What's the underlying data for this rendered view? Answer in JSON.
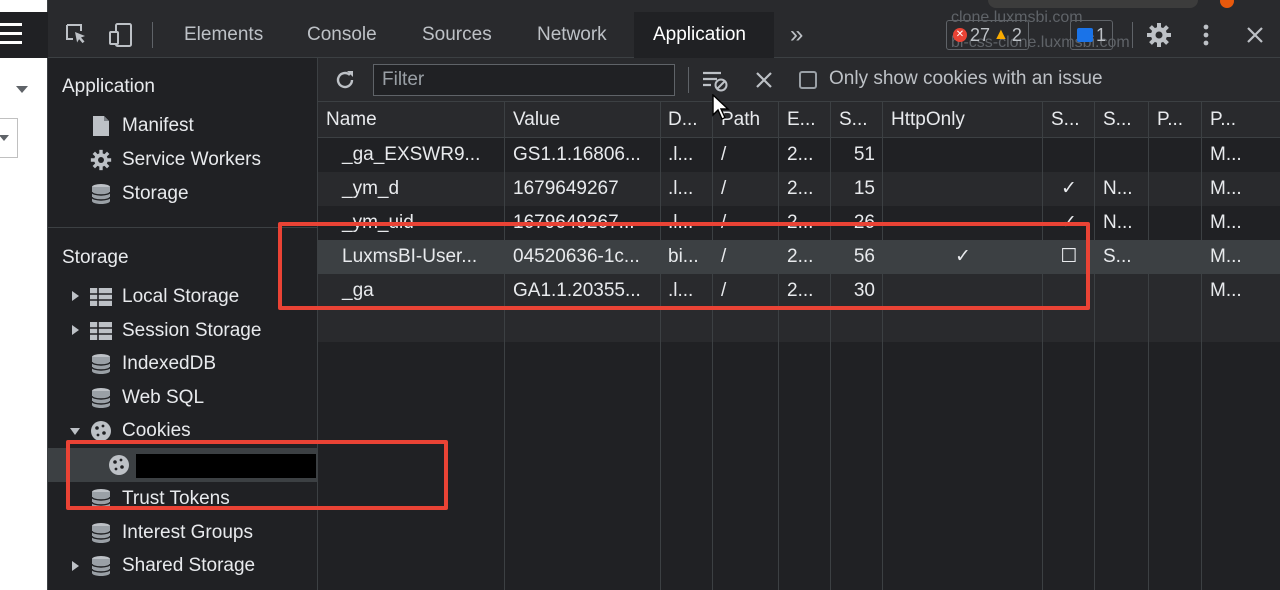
{
  "toolbar": {
    "tabs": [
      "Elements",
      "Console",
      "Sources",
      "Network",
      "Application"
    ],
    "more_tabs": "»",
    "errors": "27",
    "warnings": "2",
    "messages": "1",
    "background_text_1": "clone.luxmsbi.com",
    "background_text_2": "bi-css-clone.luxmsbi.com"
  },
  "sidebar": {
    "application_header": "Application",
    "app_items": [
      "Manifest",
      "Service Workers",
      "Storage"
    ],
    "storage_header": "Storage",
    "storage_items": [
      "Local Storage",
      "Session Storage",
      "IndexedDB",
      "Web SQL",
      "Cookies",
      "Trust Tokens",
      "Interest Groups",
      "Shared Storage"
    ]
  },
  "filterbar": {
    "placeholder": "Filter",
    "only_issue_label": "Only show cookies with an issue"
  },
  "table": {
    "columns": [
      "Name",
      "Value",
      "D...",
      "Path",
      "E...",
      "S...",
      "HttpOnly",
      "S...",
      "S...",
      "P...",
      "P..."
    ],
    "rows": [
      {
        "name": "_ga_EXSWR9...",
        "value": "GS1.1.16806...",
        "domain": ".l...",
        "path": "/",
        "expires": "2...",
        "size": "51",
        "httponly": "",
        "secure": "",
        "samesite": "",
        "partition": "",
        "priority": "M..."
      },
      {
        "name": "_ym_d",
        "value": "1679649267",
        "domain": ".l...",
        "path": "/",
        "expires": "2...",
        "size": "15",
        "httponly": "",
        "secure": "✓",
        "samesite": "N...",
        "partition": "",
        "priority": "M..."
      },
      {
        "name": "_ym_uid",
        "value": "1679649267...",
        "domain": ".l...",
        "path": "/",
        "expires": "2...",
        "size": "26",
        "httponly": "",
        "secure": "✓",
        "samesite": "N...",
        "partition": "",
        "priority": "M..."
      },
      {
        "name": "LuxmsBI-User...",
        "value": "04520636-1c...",
        "domain": "bi...",
        "path": "/",
        "expires": "2...",
        "size": "56",
        "httponly": "✓",
        "secure": "☐",
        "samesite": "S...",
        "partition": "",
        "priority": "M..."
      },
      {
        "name": "_ga",
        "value": "GA1.1.20355...",
        "domain": ".l...",
        "path": "/",
        "expires": "2...",
        "size": "30",
        "httponly": "",
        "secure": "",
        "samesite": "",
        "partition": "",
        "priority": "M..."
      }
    ]
  },
  "colors": {
    "bg": "#202124",
    "toolbar": "#292a2d",
    "annotation": "#ea4335"
  }
}
